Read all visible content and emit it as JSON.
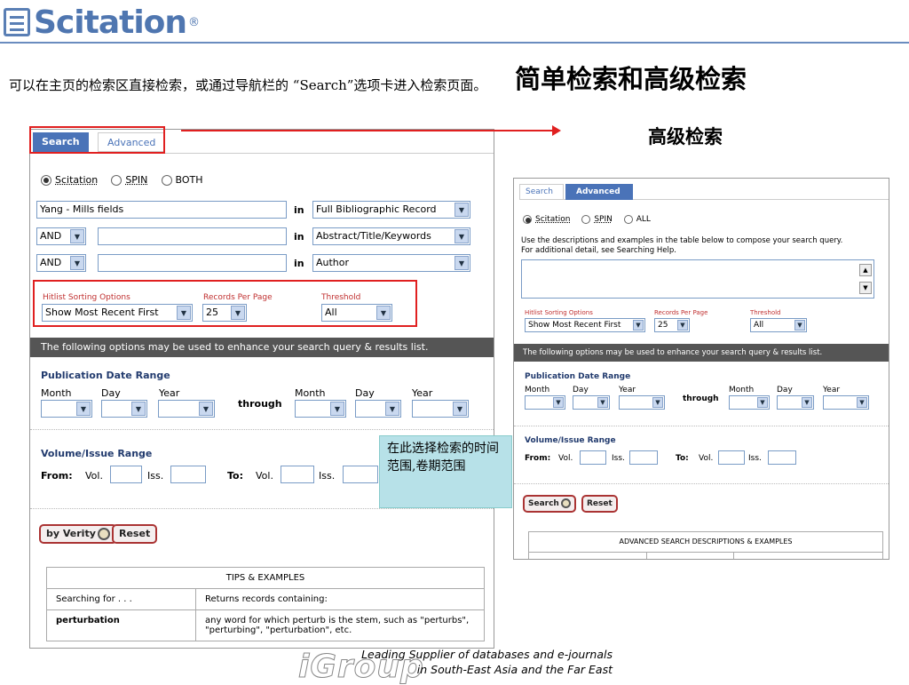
{
  "logo": {
    "name": "Scitation",
    "reg": "®"
  },
  "slide_title": "简单检索和高级检索",
  "intro_text": "可以在主页的检索区直接检索，或通过导航栏的 “Search”选项卡进入检索页面。",
  "advanced_heading": "高级检索",
  "note_text": "在此选择检索的时间范围,卷期范围",
  "left": {
    "tabs": [
      "Search",
      "Advanced"
    ],
    "radios": [
      "Scitation",
      "SPIN",
      "BOTH"
    ],
    "rows": [
      {
        "op": "",
        "value": "Yang - Mills fields",
        "in": "in",
        "field": "Full Bibliographic Record"
      },
      {
        "op": "AND",
        "value": "",
        "in": "in",
        "field": "Abstract/Title/Keywords"
      },
      {
        "op": "AND",
        "value": "",
        "in": "in",
        "field": "Author"
      }
    ],
    "sort_label": "Hitlist Sorting Options",
    "sort_value": "Show Most Recent First",
    "records_label": "Records Per Page",
    "records_value": "25",
    "threshold_label": "Threshold",
    "threshold_value": "All",
    "options_bar": "The following options may be used to enhance your search query & results list.",
    "pub_date_title": "Publication Date Range",
    "month": "Month",
    "day": "Day",
    "year": "Year",
    "through": "through",
    "vol_title": "Volume/Issue Range",
    "from": "From:",
    "to": "To:",
    "vol": "Vol.",
    "iss": "Iss.",
    "by_verity": "by Verity",
    "reset": "Reset",
    "tips_header": "TIPS & EXAMPLES",
    "tips_col1": "Searching for . . .",
    "tips_col2": "Returns records containing:",
    "tips_term": "perturbation",
    "tips_desc": "any word for which perturb is the stem, such as \"perturbs\", \"perturbing\", \"perturbation\", etc."
  },
  "right": {
    "tabs": [
      "Search",
      "Advanced"
    ],
    "radios": [
      "Scitation",
      "SPIN",
      "ALL"
    ],
    "instructions_1": "Use the descriptions and examples in the table below to compose your search query.",
    "instructions_2": "For additional detail, see Searching Help.",
    "sort_label": "Hitlist Sorting Options",
    "sort_value": "Show Most Recent First",
    "records_label": "Records Per Page",
    "records_value": "25",
    "threshold_label": "Threshold",
    "threshold_value": "All",
    "options_bar": "The following options may be used to enhance your search query & results list.",
    "pub_date_title": "Publication Date Range",
    "month": "Month",
    "day": "Day",
    "year": "Year",
    "through": "through",
    "vol_title": "Volume/Issue Range",
    "from": "From:",
    "to": "To:",
    "vol": "Vol.",
    "iss": "Iss.",
    "search": "Search",
    "reset": "Reset",
    "table_header": "ADVANCED SEARCH DESCRIPTIONS & EXAMPLES"
  },
  "footer": {
    "brand": "iGroup",
    "line1": "Leading Supplier of databases and e-journals",
    "line2": "in South-East Asia and the Far East"
  }
}
